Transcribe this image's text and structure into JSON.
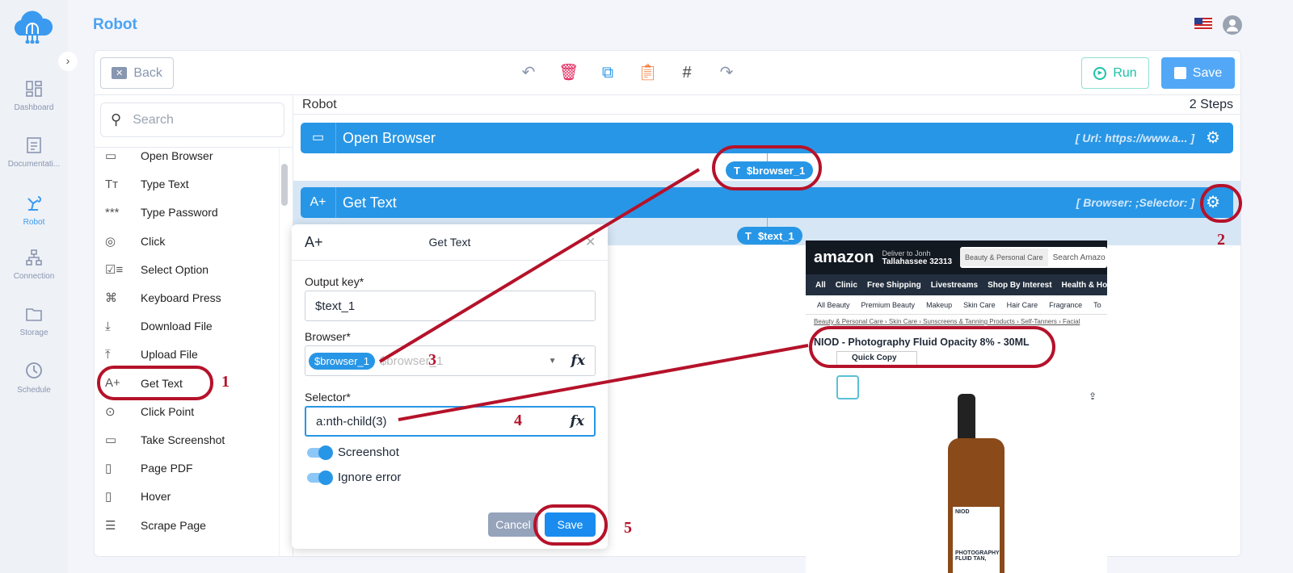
{
  "app": {
    "title": "Robot"
  },
  "sidebar": {
    "items": [
      {
        "label": "Dashboard",
        "icon": "dashboard-icon"
      },
      {
        "label": "Documentati...",
        "icon": "document-icon"
      },
      {
        "label": "Robot",
        "icon": "robot-icon",
        "active": true
      },
      {
        "label": "Connection",
        "icon": "connection-icon"
      },
      {
        "label": "Storage",
        "icon": "folder-icon"
      },
      {
        "label": "Schedule",
        "icon": "clock-icon"
      }
    ]
  },
  "toolbar": {
    "back": "Back",
    "run": "Run",
    "save": "Save",
    "hash": "#"
  },
  "palette": {
    "search_placeholder": "Search",
    "items": [
      {
        "label": "Open Browser",
        "icon": "▭"
      },
      {
        "label": "Type Text",
        "icon": "Tт"
      },
      {
        "label": "Type Password",
        "icon": "***"
      },
      {
        "label": "Click",
        "icon": "◎"
      },
      {
        "label": "Select Option",
        "icon": "☑≡"
      },
      {
        "label": "Keyboard Press",
        "icon": "⌘"
      },
      {
        "label": "Download File",
        "icon": "⤓"
      },
      {
        "label": "Upload File",
        "icon": "⤒"
      },
      {
        "label": "Get Text",
        "icon": "A+"
      },
      {
        "label": "Click Point",
        "icon": "⊙"
      },
      {
        "label": "Take Screenshot",
        "icon": "▭"
      },
      {
        "label": "Page PDF",
        "icon": "▯"
      },
      {
        "label": "Hover",
        "icon": "▯"
      },
      {
        "label": "Scrape Page",
        "icon": "☰"
      }
    ]
  },
  "flow": {
    "title": "Robot",
    "steps_count": "2 Steps",
    "steps": [
      {
        "icon": "▭",
        "label": "Open Browser",
        "params": "[ Url: https://www.a...  ]",
        "output": "$browser_1"
      },
      {
        "icon": "A+",
        "label": "Get Text",
        "params": "[ Browser:  ;Selector:  ]",
        "output": "$text_1"
      }
    ]
  },
  "dialog": {
    "icon": "A+",
    "title": "Get Text",
    "output_key_label": "Output key*",
    "output_key": "$text_1",
    "browser_label": "Browser*",
    "browser_chip": "$browser_1",
    "browser_placeholder": "$browser_1",
    "selector_label": "Selector*",
    "selector": "a:nth-child(3)",
    "fx": "fx",
    "screenshot": "Screenshot",
    "ignore_error": "Ignore error",
    "screenshot_on": true,
    "ignore_error_on": true,
    "cancel": "Cancel",
    "save": "Save"
  },
  "amazon": {
    "logo": "amazon",
    "deliver": "Deliver to Jonh",
    "location": "Tallahassee 32313",
    "category": "Beauty & Personal Care",
    "search": "Search Amazo",
    "nav": [
      "All",
      "Clinic",
      "Free Shipping",
      "Livestreams",
      "Shop By Interest",
      "Health & Househo"
    ],
    "subnav": [
      "All Beauty",
      "Premium Beauty",
      "Makeup",
      "Skin Care",
      "Hair Care",
      "Fragrance",
      "To"
    ],
    "breadcrumb": "Beauty & Personal Care › Skin Care › Sunscreens & Tanning Products › Self-Tanners › Facial",
    "product_title": "NIOD - Photography Fluid Opacity 8% - 30ML",
    "quick_copy": "Quick Copy",
    "label_brand": "NIOD",
    "label_text": "PHOTOGRAPHY FLUID TAN,"
  },
  "annotations": [
    "1",
    "2",
    "3",
    "4",
    "5"
  ],
  "colors": {
    "accent": "#2896e6",
    "annotation": "#b5122a",
    "run": "#1cc1a8"
  }
}
